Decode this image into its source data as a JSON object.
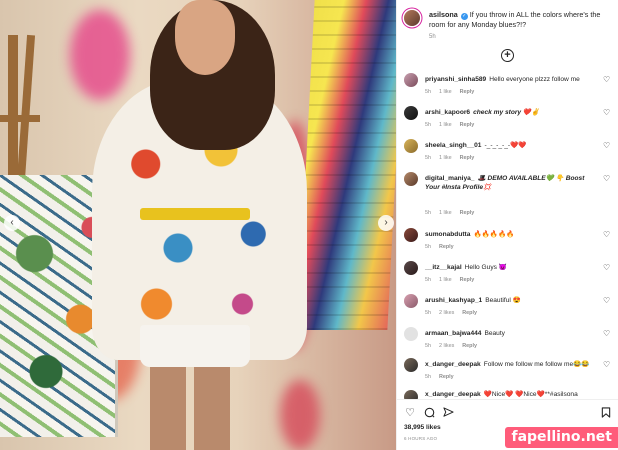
{
  "post": {
    "author": "asilsona",
    "caption": "If you throw in ALL the colors where's the room for any Monday blues?!?",
    "caption_time": "5h",
    "likes": "38,995 likes",
    "date": "6 HOURS AGO"
  },
  "comments": [
    {
      "user": "priyanshi_sinha589",
      "text": "Hello everyone plzzz follow me",
      "time": "5h",
      "likes": "1 like",
      "reply": "Reply"
    },
    {
      "user": "arshi_kapoor6",
      "text": "check my story ❤️✌️",
      "time": "5h",
      "likes": "1 like",
      "reply": "Reply"
    },
    {
      "user": "sheela_singh__01",
      "text": "-_-_-_-_-❤️❤️",
      "time": "5h",
      "likes": "1 like",
      "reply": "Reply"
    },
    {
      "user": "digital_maniya_",
      "text": "🎩 DEMO AVAILABLE💚 👇 Boost Your #Insta Profile💢",
      "time": "5h",
      "likes": "1 like",
      "reply": "Reply"
    },
    {
      "user": "sumonabdutta",
      "text": "🔥🔥🔥🔥🔥",
      "time": "5h",
      "likes": "",
      "reply": "Reply"
    },
    {
      "user": "__itz__kajal",
      "text": "Hello Guys 😈",
      "time": "5h",
      "likes": "1 like",
      "reply": "Reply"
    },
    {
      "user": "arushi_kashyap_1",
      "text": "Beautiful 😍",
      "time": "5h",
      "likes": "2 likes",
      "reply": "Reply"
    },
    {
      "user": "armaan_bajwa444",
      "text": "Beauty",
      "time": "5h",
      "likes": "2 likes",
      "reply": "Reply"
    },
    {
      "user": "x_danger_deepak",
      "text": "Follow me follow me follow me😂😂",
      "time": "5h",
      "likes": "",
      "reply": "Reply"
    },
    {
      "user": "x_danger_deepak",
      "text": "❤️Nice❤️ ❤️Nice❤️**#asilsona",
      "time": "",
      "likes": "",
      "reply": ""
    }
  ],
  "icons": {
    "like": "heart-icon",
    "comment": "comment-icon",
    "share": "share-icon",
    "save": "bookmark-icon",
    "load_more": "plus-circle-icon"
  },
  "watermark": "fapellino.net"
}
